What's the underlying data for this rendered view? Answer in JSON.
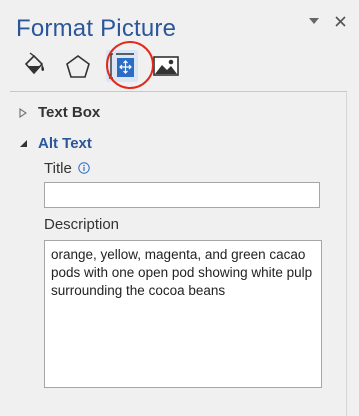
{
  "pane": {
    "title": "Format Picture"
  },
  "tabs": [
    {
      "name": "Fill & Line"
    },
    {
      "name": "Effects"
    },
    {
      "name": "Size & Properties"
    },
    {
      "name": "Picture"
    }
  ],
  "sections": {
    "text_box": {
      "label": "Text Box"
    },
    "alt_text": {
      "label": "Alt Text",
      "title_label": "Title",
      "title_value": "",
      "description_label": "Description",
      "description_value": "orange, yellow, magenta, and green cacao pods with one open pod showing white pulp surrounding the cocoa beans"
    }
  },
  "colors": {
    "accent": "#2b579a",
    "highlight_ring": "#e02a1b"
  }
}
